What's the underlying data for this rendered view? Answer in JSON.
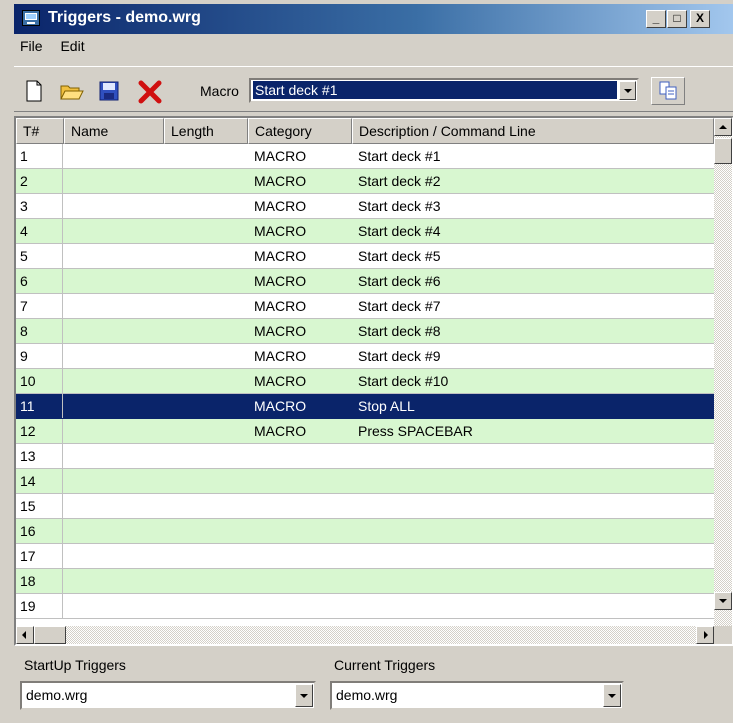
{
  "window": {
    "title": "Triggers - demo.wrg",
    "controls": [
      "_",
      "□",
      "X"
    ]
  },
  "menu": [
    "File",
    "Edit"
  ],
  "toolbar": {
    "buttons": [
      "new-file-icon",
      "open-folder-icon",
      "save-disk-icon",
      "delete-x-icon",
      "copy-icon"
    ],
    "macro_label": "Macro",
    "macro_value": "Start deck #1"
  },
  "grid": {
    "columns": [
      "T#",
      "Name",
      "Length",
      "Category",
      "Description / Command Line"
    ],
    "rows": [
      {
        "t": "1",
        "name": "",
        "length": "",
        "category": "MACRO",
        "description": "Start deck #1"
      },
      {
        "t": "2",
        "name": "",
        "length": "",
        "category": "MACRO",
        "description": "Start deck #2"
      },
      {
        "t": "3",
        "name": "",
        "length": "",
        "category": "MACRO",
        "description": "Start deck #3"
      },
      {
        "t": "4",
        "name": "",
        "length": "",
        "category": "MACRO",
        "description": "Start deck #4"
      },
      {
        "t": "5",
        "name": "",
        "length": "",
        "category": "MACRO",
        "description": "Start deck #5"
      },
      {
        "t": "6",
        "name": "",
        "length": "",
        "category": "MACRO",
        "description": "Start deck #6"
      },
      {
        "t": "7",
        "name": "",
        "length": "",
        "category": "MACRO",
        "description": "Start deck #7"
      },
      {
        "t": "8",
        "name": "",
        "length": "",
        "category": "MACRO",
        "description": "Start deck #8"
      },
      {
        "t": "9",
        "name": "",
        "length": "",
        "category": "MACRO",
        "description": "Start deck #9"
      },
      {
        "t": "10",
        "name": "",
        "length": "",
        "category": "MACRO",
        "description": "Start deck #10"
      },
      {
        "t": "11",
        "name": "",
        "length": "",
        "category": "MACRO",
        "description": "Stop ALL"
      },
      {
        "t": "12",
        "name": "",
        "length": "",
        "category": "MACRO",
        "description": "Press SPACEBAR"
      },
      {
        "t": "13",
        "name": "",
        "length": "",
        "category": "",
        "description": ""
      },
      {
        "t": "14",
        "name": "",
        "length": "",
        "category": "",
        "description": ""
      },
      {
        "t": "15",
        "name": "",
        "length": "",
        "category": "",
        "description": ""
      },
      {
        "t": "16",
        "name": "",
        "length": "",
        "category": "",
        "description": ""
      },
      {
        "t": "17",
        "name": "",
        "length": "",
        "category": "",
        "description": ""
      },
      {
        "t": "18",
        "name": "",
        "length": "",
        "category": "",
        "description": ""
      },
      {
        "t": "19",
        "name": "",
        "length": "",
        "category": "",
        "description": ""
      }
    ],
    "selected_row": "11",
    "colors": {
      "alt_row": "#d8f7d0",
      "selection": "#0a246a"
    }
  },
  "bottom": {
    "startup_label": "StartUp Triggers",
    "startup_value": "demo.wrg",
    "current_label": "Current Triggers",
    "current_value": "demo.wrg"
  }
}
